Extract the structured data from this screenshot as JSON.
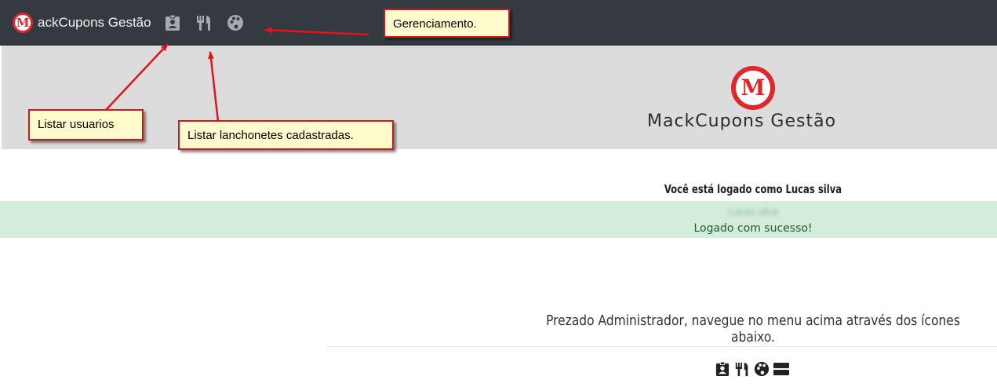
{
  "navbar": {
    "brand_logo_letter": "M",
    "brand_text": "ackCupons Gestão",
    "icons": [
      "user-badge-icon",
      "utensils-icon",
      "palette-icon"
    ]
  },
  "header": {
    "logo_letter": "M",
    "title": "MackCupons Gestão"
  },
  "status": {
    "logged_as": "Você está logado como Lucas silva",
    "blurred_name": "Lucas silva",
    "success_message": "Logado com sucesso!"
  },
  "main": {
    "instruction": "Prezado Administrador, navegue no menu acima através dos ícones abaixo.",
    "bottom_icons": [
      "user-badge-icon",
      "utensils-icon",
      "palette-icon",
      "list-icon"
    ]
  },
  "callouts": {
    "management": "Gerenciamento.",
    "list_users": "Listar usuarios",
    "list_snackbars": "Listar lanchonetes cadastradas."
  },
  "colors": {
    "navbar_bg": "#343a40",
    "header_bg": "#dcdcdc",
    "brand_red": "#e0282c",
    "alert_bg": "#d4edda",
    "alert_text": "#1f5e2e",
    "callout_bg": "#fffbcc",
    "callout_border": "#cc1a1a"
  }
}
